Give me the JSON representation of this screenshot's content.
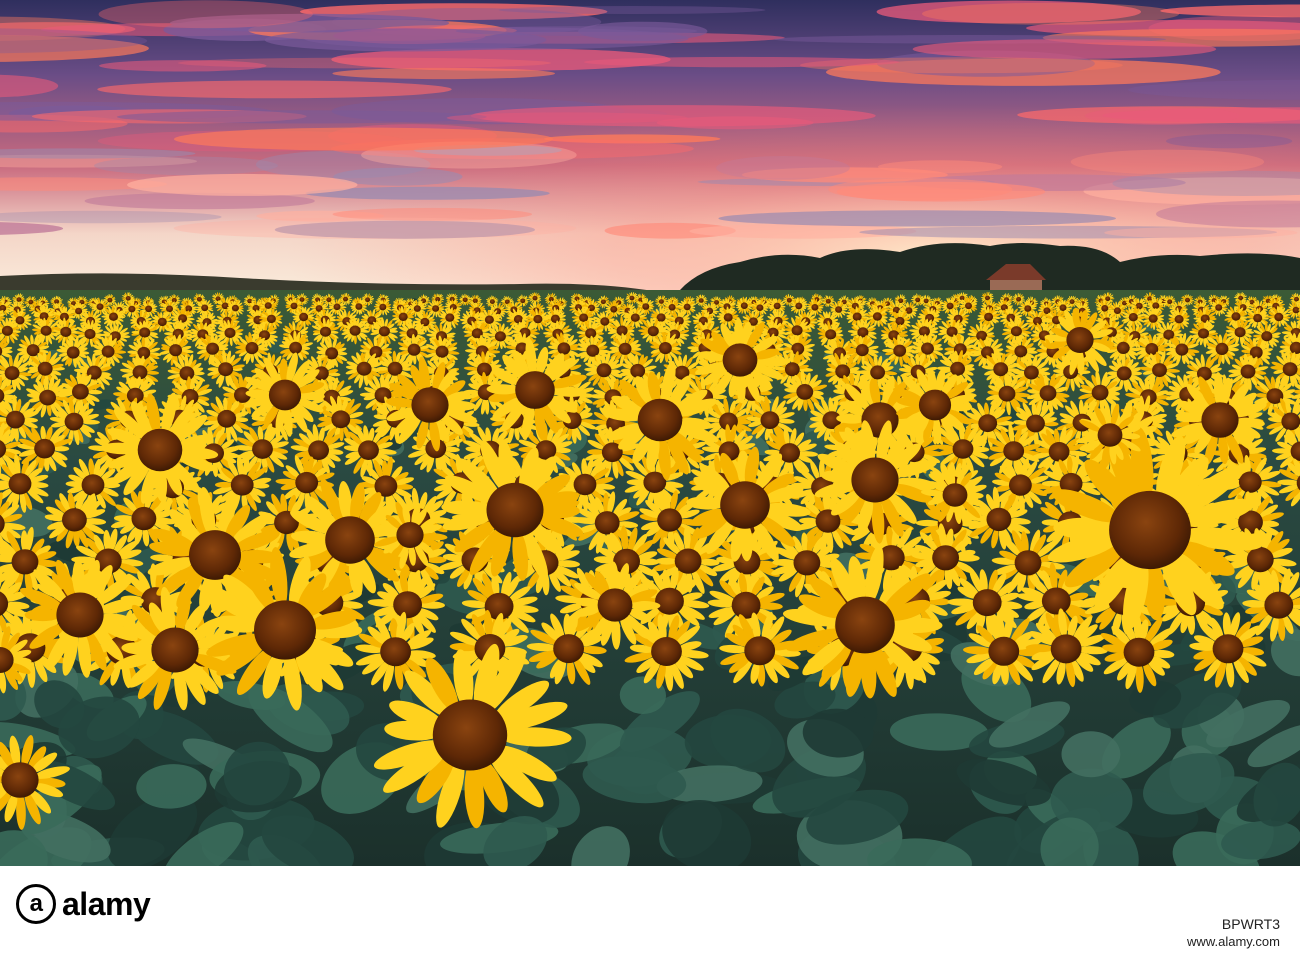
{
  "watermark": {
    "logo_text": "alamy",
    "logo_mark": "a",
    "image_id": "BPWRT3",
    "site": "www.alamy.com"
  },
  "scene": {
    "sky_top": "#5b4a7e",
    "sky_glow": "#ff5a5a",
    "horizon": "#f6e9d5",
    "petal": "#ffd21e",
    "petal_dark": "#e8a400",
    "disk": "#6a2f08",
    "leaf": "#2f5a4f",
    "leaf_dark": "#1d3b34"
  }
}
